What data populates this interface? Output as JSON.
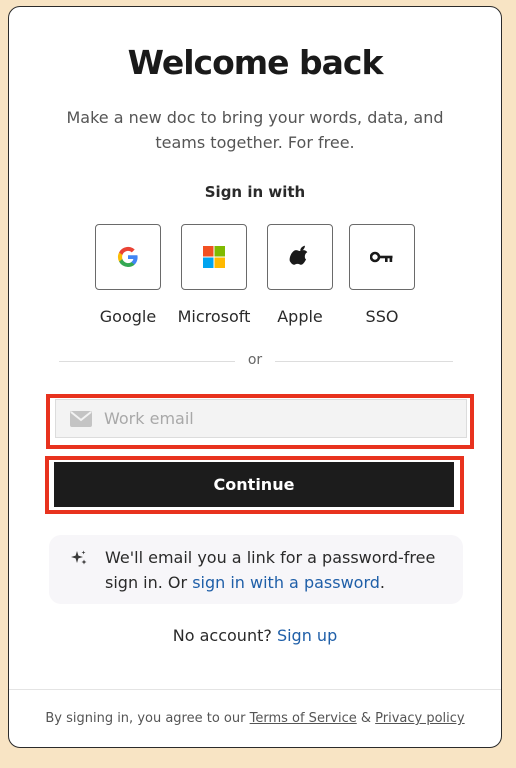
{
  "header": {
    "title": "Welcome back",
    "subtitle": "Make a new doc to bring your words, data, and teams together. For free."
  },
  "signin": {
    "label": "Sign in with",
    "providers": [
      {
        "label": "Google",
        "icon": "google-icon"
      },
      {
        "label": "Microsoft",
        "icon": "microsoft-icon"
      },
      {
        "label": "Apple",
        "icon": "apple-icon"
      },
      {
        "label": "SSO",
        "icon": "key-icon"
      }
    ],
    "divider_text": "or"
  },
  "email": {
    "placeholder": "Work email",
    "value": "",
    "icon": "envelope-icon"
  },
  "continue_label": "Continue",
  "info": {
    "text": "We'll email you a link for a password-free sign in. Or",
    "link": "sign in with a password",
    "suffix": ".",
    "icon": "sparkle-icon"
  },
  "signup": {
    "text": "No account?",
    "link": "Sign up"
  },
  "footer": {
    "prefix": "By signing in, you agree to our",
    "terms": "Terms of Service",
    "amp": "&",
    "privacy": "Privacy policy"
  },
  "colors": {
    "background": "#f8e4c4",
    "button": "#1c1c1c",
    "link": "#1f5fa8",
    "highlight": "#e8321e"
  }
}
